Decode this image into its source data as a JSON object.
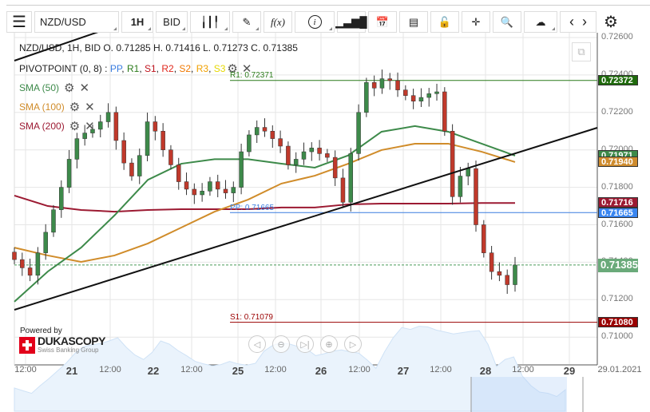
{
  "toolbar": {
    "symbol": "NZD/USD",
    "timeframe": "1H",
    "side": "BID",
    "icons": [
      "menu-icon",
      "candle-type-icon",
      "draw-pencil-icon",
      "function-icon",
      "info-icon",
      "bar-chart-icon",
      "calendar-icon",
      "report-icon",
      "unlock-icon",
      "crosshair-icon",
      "zoom-search-icon",
      "cloud-upload-icon",
      "chevron-left-icon",
      "chevron-right-icon",
      "gear-icon"
    ],
    "fx": "f(x)"
  },
  "legend": {
    "ohlc": "NZD/USD, 1H, BID   O. 0.71285 H. 0.71416 L. 0.71273 C. 0.71385",
    "pivot_name": "PIVOTPOINT (0, 8)",
    "pivot_sep": " : ",
    "pivot_levels": [
      {
        "t": "PP",
        "c": "#3a7de0"
      },
      {
        "t": "R1",
        "c": "#2a7a1a"
      },
      {
        "t": "S1",
        "c": "#c0141e"
      },
      {
        "t": "R2",
        "c": "#e0281e"
      },
      {
        "t": "S2",
        "c": "#f07800"
      },
      {
        "t": "R3",
        "c": "#f0a000"
      },
      {
        "t": "S3",
        "c": "#e6d800"
      }
    ],
    "indicators": [
      {
        "label": "SMA (50)",
        "color": "#3d8a4a"
      },
      {
        "label": "SMA (100)",
        "color": "#d08c2a"
      },
      {
        "label": "SMA (200)",
        "color": "#9c1a32"
      }
    ]
  },
  "levels": {
    "r1": {
      "label": "R1: 0.72371",
      "value": 0.72371,
      "box": "0.72372",
      "color": "#1f6a0c"
    },
    "pp": {
      "label": "PP: 0.71665",
      "value": 0.71665,
      "box": "0.71665",
      "color": "#3a86f0"
    },
    "s1": {
      "label": "S1: 0.71079",
      "value": 0.71079,
      "box": "0.71080",
      "color": "#9a0000"
    },
    "sma50": {
      "box": "0.71971",
      "color": "#3d8a4a"
    },
    "sma100": {
      "box": "0.71940",
      "color": "#cf8c2e"
    },
    "sma200": {
      "box": "0.71716",
      "color": "#9c1a32"
    },
    "last": {
      "box": "0.71385",
      "value": 0.71385,
      "color": "#6aaa7a"
    }
  },
  "y_axis": [
    "0.72600",
    "0.72400",
    "0.72200",
    "0.72000",
    "0.71800",
    "0.71600",
    "0.71400",
    "0.71200",
    "0.71000"
  ],
  "x_axis": [
    "12:00",
    "21",
    "12:00",
    "22",
    "12:00",
    "25",
    "12:00",
    "26",
    "12:00",
    "27",
    "12:00",
    "28",
    "12:00",
    "29",
    "29.01.2021"
  ],
  "branding": {
    "powered": "Powered by",
    "name": "DUKASCOPY",
    "tag": "Swiss Banking Group"
  },
  "nav_buttons": [
    "scroll-left",
    "zoom-out",
    "go-to-end",
    "zoom-in",
    "scroll-right"
  ],
  "chart_data": {
    "type": "candlestick",
    "ylim": [
      0.709,
      0.7265
    ],
    "grid": true,
    "closes": [
      0.71414,
      0.7137,
      0.7133,
      0.7145,
      0.7156,
      0.7168,
      0.718,
      0.7195,
      0.7206,
      0.7209,
      0.7211,
      0.7215,
      0.722,
      0.7205,
      0.7193,
      0.7186,
      0.7197,
      0.7215,
      0.721,
      0.72,
      0.7192,
      0.7183,
      0.7179,
      0.7176,
      0.7178,
      0.7183,
      0.7179,
      0.7177,
      0.718,
      0.7199,
      0.7208,
      0.7212,
      0.721,
      0.7206,
      0.7202,
      0.7192,
      0.7195,
      0.7199,
      0.7201,
      0.7198,
      0.7196,
      0.7185,
      0.7172,
      0.7198,
      0.722,
      0.7236,
      0.7233,
      0.7238,
      0.7237,
      0.7232,
      0.7229,
      0.7226,
      0.7228,
      0.723,
      0.7231,
      0.721,
      0.7175,
      0.7186,
      0.719,
      0.716,
      0.7145,
      0.7135,
      0.7133,
      0.7128,
      0.71385
    ],
    "sma50": [
      0.71189,
      0.7135,
      0.71478,
      0.7165,
      0.7184,
      0.71926,
      0.7195,
      0.7195,
      0.71926,
      0.71905,
      0.7197,
      0.72097,
      0.72127,
      0.72097,
      0.72033,
      0.71969
    ],
    "sma100": [
      0.71478,
      0.71436,
      0.71402,
      0.71436,
      0.715,
      0.71585,
      0.7167,
      0.71734,
      0.7182,
      0.71862,
      0.71926,
      0.71999,
      0.72033,
      0.72033,
      0.7199,
      0.71935
    ],
    "sma200": [
      0.71756,
      0.717,
      0.71679,
      0.7167,
      0.71679,
      0.71683,
      0.71683,
      0.71683,
      0.71692,
      0.71692,
      0.71709,
      0.71713,
      0.71713,
      0.71713,
      0.71716,
      0.71716
    ]
  }
}
